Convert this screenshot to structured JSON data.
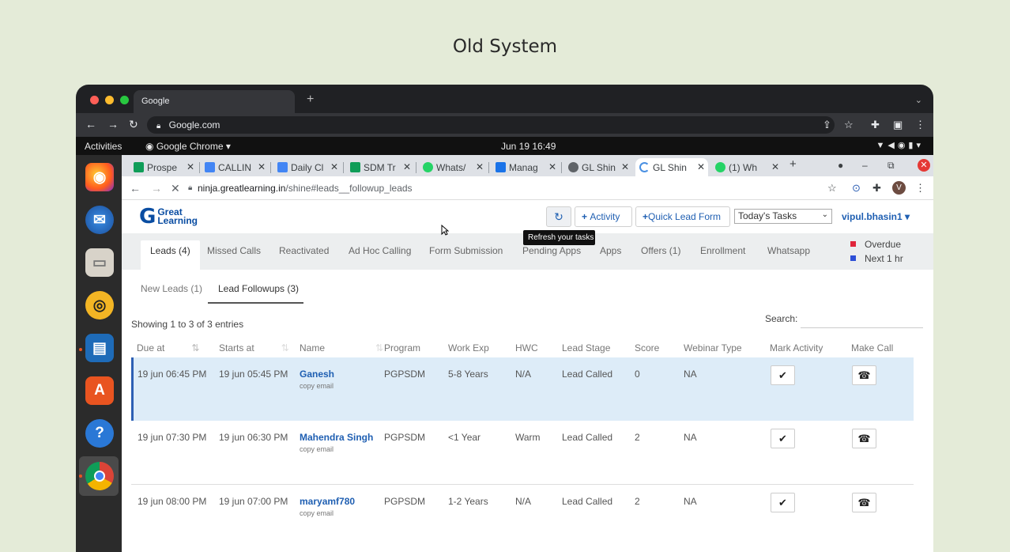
{
  "page_title": "Old System",
  "outer_browser": {
    "tab_label": "Google",
    "url": "Google.com"
  },
  "ubuntu_bar": {
    "activities": "Activities",
    "app": "Google Chrome ▾",
    "clock": "Jun 19  16:49"
  },
  "inner_browser": {
    "tabs": [
      {
        "label": "Prospe",
        "color": "#0f9d58"
      },
      {
        "label": "CALLIN",
        "color": "#4285f4"
      },
      {
        "label": "Daily Cl",
        "color": "#4285f4"
      },
      {
        "label": "SDM Tr",
        "color": "#0f9d58"
      },
      {
        "label": "Whats/",
        "color": "#25d366"
      },
      {
        "label": "Manag",
        "color": "#1a73e8"
      },
      {
        "label": "GL Shin",
        "color": "#5f6368"
      },
      {
        "label": "GL Shin",
        "color": "#4a90e2"
      },
      {
        "label": "(1) Wh",
        "color": "#25d366"
      }
    ],
    "url_host": "ninja.greatlearning.in",
    "url_path": "/shine#leads__followup_leads",
    "avatar_letter": "V"
  },
  "app": {
    "logo_g": "G",
    "logo_line1": "Great",
    "logo_line2": "Learning",
    "activity_label": "Activity",
    "quick_lead_label": "Quick Lead Form",
    "tasks_select": "Today's Tasks",
    "user": "vipul.bhasin1 ▾",
    "tooltip": "Refresh your tasks",
    "main_tabs": [
      "Leads (4)",
      "Missed Calls",
      "Reactivated",
      "Ad Hoc Calling",
      "Form Submission",
      "Pending Apps",
      "Apps",
      "Offers (1)",
      "Enrollment",
      "Whatsapp"
    ],
    "legend": [
      {
        "label": "Overdue",
        "color": "#e0253b"
      },
      {
        "label": "Next 1 hr",
        "color": "#2d4fd6"
      }
    ],
    "sub_tabs": [
      "New Leads (1)",
      "Lead Followups (3)"
    ],
    "showing": "Showing 1 to 3 of 3 entries",
    "search_label": "Search:",
    "columns": [
      "Due at",
      "Starts at",
      "Name",
      "Program",
      "Work Exp",
      "HWC",
      "Lead Stage",
      "Score",
      "Webinar Type",
      "Mark Activity",
      "Make Call"
    ],
    "copy_email": "copy email",
    "rows": [
      {
        "due": "19 jun 06:45 PM",
        "starts": "19 jun 05:45 PM",
        "name": "Ganesh",
        "program": "PGPSDM",
        "exp": "5-8 Years",
        "hwc": "N/A",
        "stage": "Lead Called",
        "score": "0",
        "webinar": "NA"
      },
      {
        "due": "19 jun 07:30 PM",
        "starts": "19 jun 06:30 PM",
        "name": "Mahendra Singh",
        "program": "PGPSDM",
        "exp": "<1 Year",
        "hwc": "Warm",
        "stage": "Lead Called",
        "score": "2",
        "webinar": "NA"
      },
      {
        "due": "19 jun 08:00 PM",
        "starts": "19 jun 07:00 PM",
        "name": "maryamf780",
        "program": "PGPSDM",
        "exp": "1-2 Years",
        "hwc": "N/A",
        "stage": "Lead Called",
        "score": "2",
        "webinar": "NA"
      }
    ]
  }
}
